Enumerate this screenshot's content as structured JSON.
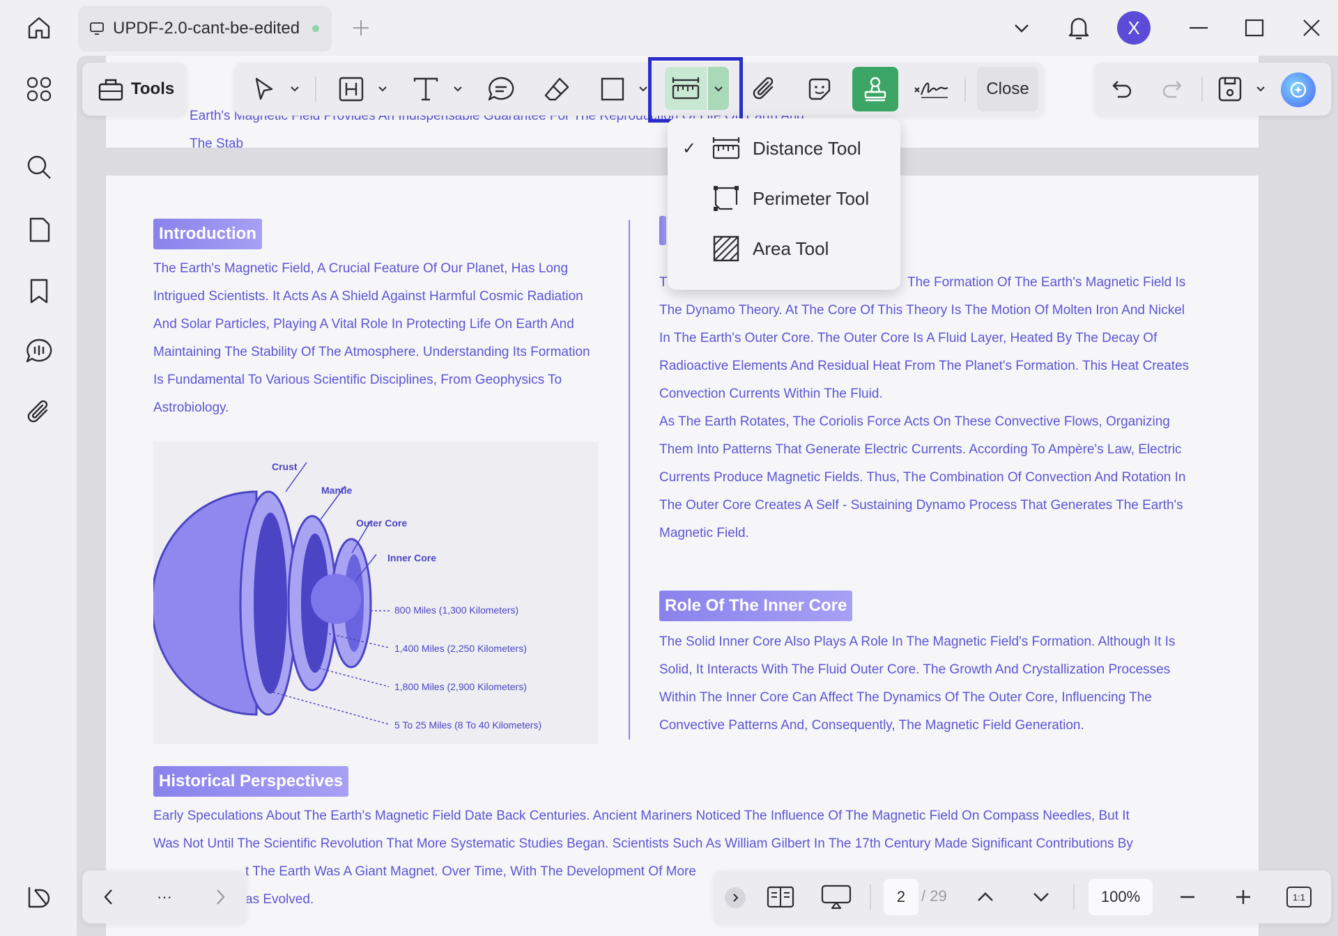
{
  "window": {
    "tab_title": "UPDF-2.0-cant-be-edited",
    "avatar_letter": "X"
  },
  "toolbar": {
    "tools_label": "Tools",
    "close_label": "Close"
  },
  "measure_menu": {
    "items": [
      {
        "label": "Distance Tool",
        "checked": true,
        "icon": "ruler-icon"
      },
      {
        "label": "Perimeter Tool",
        "checked": false,
        "icon": "perimeter-icon"
      },
      {
        "label": "Area Tool",
        "checked": false,
        "icon": "area-icon"
      }
    ],
    "check_mark": "✓"
  },
  "document": {
    "top_lines": [
      "Earth's Magnetic Field Provides An Indispensable Guarantee For The Reproduction Of Life On Earth And",
      "The Stab"
    ],
    "introduction": {
      "heading": "Introduction",
      "lines": [
        "The Earth's Magnetic Field, A Crucial Feature Of Our Planet, Has Long",
        "Intrigued Scientists. It Acts As A Shield Against Harmful Cosmic Radiation",
        "And Solar Particles, Playing A Vital Role In Protecting Life On Earth And",
        "Maintaining The Stability Of The Atmosphere. Understanding Its Formation",
        "Is Fundamental To Various Scientific Disciplines, From Geophysics To",
        "Astrobiology."
      ]
    },
    "diagram": {
      "labels": {
        "crust": "Crust",
        "mantle": "Mantle",
        "outer_core": "Outer Core",
        "inner_core": "Inner Core"
      },
      "distances": [
        "800 Miles (1,300 Kilometers)",
        "1,400 Miles (2,250 Kilometers)",
        "1,800 Miles (2,900 Kilometers)",
        "5 To 25 Miles (8 To 40 Kilometers)"
      ]
    },
    "dynamo": {
      "first_line_fragment_left": "T",
      "first_line_fragment_right": "The Formation Of The Earth's Magnetic Field Is",
      "lines": [
        "The Dynamo Theory. At The Core Of This Theory Is The Motion Of Molten Iron And Nickel",
        "In The Earth's Outer Core. The Outer Core Is A Fluid Layer, Heated By The Decay Of",
        "Radioactive Elements And Residual Heat From The Planet's Formation. This Heat Creates",
        "Convection Currents Within The Fluid.",
        "As The Earth Rotates, The Coriolis Force Acts On These Convective Flows, Organizing",
        "Them Into Patterns That Generate Electric Currents. According To Ampère's Law, Electric",
        "Currents Produce Magnetic Fields. Thus, The Combination Of Convection And Rotation In",
        "The Outer Core Creates A Self - Sustaining Dynamo Process That Generates The Earth's",
        "Magnetic Field."
      ]
    },
    "inner_core": {
      "heading": "Role Of The Inner Core",
      "lines": [
        "The Solid Inner Core Also Plays A Role In The Magnetic Field's Formation. Although It Is",
        "Solid, It Interacts With The Fluid Outer Core. The Growth And Crystallization Processes",
        "Within The Inner Core Can Affect The Dynamics Of The Outer Core, Influencing The",
        "Convective Patterns And, Consequently, The Magnetic Field Generation."
      ]
    },
    "historical": {
      "heading": "Historical Perspectives",
      "lines": [
        "Early Speculations About The Earth's Magnetic Field Date Back Centuries. Ancient Mariners Noticed The Influence Of The Magnetic Field On Compass Needles, But It",
        "Was Not Until The Scientific Revolution That More Systematic Studies Began. Scientists Such As William Gilbert In The 17th Century Made Significant Contributions By",
        "t The Earth Was A Giant Magnet. Over Time, With The Development Of More",
        "as Evolved."
      ]
    }
  },
  "bottom": {
    "ellipsis": "···",
    "page_current": "2",
    "page_total": "/ 29",
    "zoom": "100%",
    "fit_label": "1:1"
  },
  "colors": {
    "accent": "#5b55d4",
    "heading_bg": "#8a82ec",
    "measure_highlight": "#2b2ccc",
    "stamp_green": "#3aa565",
    "avatar": "#5b4bd6"
  }
}
